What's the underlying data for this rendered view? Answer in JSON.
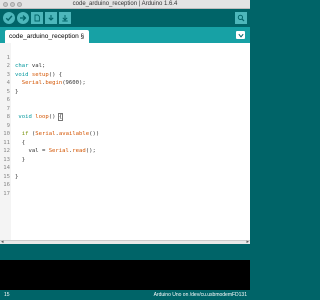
{
  "window": {
    "title": "code_arduino_reception | Arduino 1.6.4"
  },
  "toolbar": {
    "buttons": [
      "verify-icon",
      "upload-icon",
      "new-icon",
      "open-icon",
      "save-icon"
    ],
    "serial_monitor": "magnifier-icon"
  },
  "tabs": [
    {
      "label": "code_arduino_reception §"
    }
  ],
  "editor": {
    "lines": [
      {
        "n": "1",
        "t": "char val;"
      },
      {
        "n": "2",
        "t": "void setup() {"
      },
      {
        "n": "3",
        "t": "  Serial.begin(9600);"
      },
      {
        "n": "4",
        "t": "}"
      },
      {
        "n": "5",
        "t": ""
      },
      {
        "n": "6",
        "t": ""
      },
      {
        "n": "7",
        "t": " void loop() {"
      },
      {
        "n": "8",
        "t": ""
      },
      {
        "n": "9",
        "t": "  if (Serial.available())"
      },
      {
        "n": "10",
        "t": "  {"
      },
      {
        "n": "11",
        "t": "    val = Serial.read();"
      },
      {
        "n": "12",
        "t": "  }"
      },
      {
        "n": "13",
        "t": ""
      },
      {
        "n": "14",
        "t": "}"
      },
      {
        "n": "15",
        "t": ""
      },
      {
        "n": "16",
        "t": ""
      },
      {
        "n": "17",
        "t": ""
      }
    ]
  },
  "status": {
    "line": "15",
    "board": "Arduino Uno on /dev/cu.usbmodemFD131"
  },
  "colors": {
    "teal_dark": "#006468",
    "teal_mid": "#17a1a5",
    "teal_light": "#4db7bb",
    "keyword_type": "#00979c",
    "keyword_fn": "#d35400",
    "keyword_ctl": "#728e00"
  }
}
